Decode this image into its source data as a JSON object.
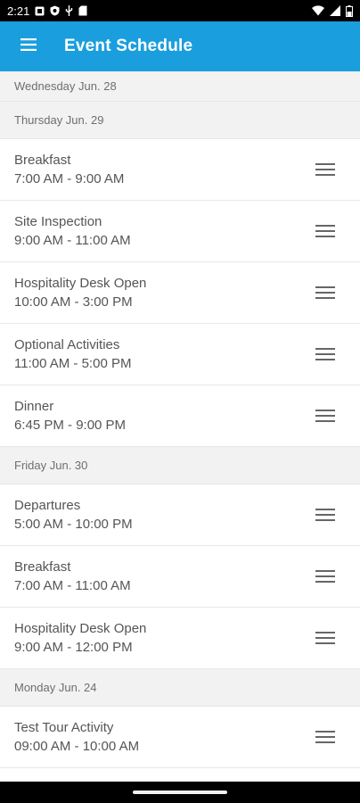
{
  "status_bar": {
    "time": "2:21",
    "icons_left": [
      "square-app-icon",
      "shield-icon",
      "usb-icon",
      "sd-card-icon"
    ],
    "icons_right": [
      "wifi-icon",
      "signal-icon",
      "battery-icon"
    ]
  },
  "app_bar": {
    "menu_icon": "hamburger-icon",
    "title": "Event Schedule",
    "color": "#1a9ede"
  },
  "sections": [
    {
      "date": "Wednesday Jun. 28",
      "events": []
    },
    {
      "date": "Thursday Jun. 29",
      "events": [
        {
          "name": "Breakfast",
          "time": "7:00 AM - 9:00 AM"
        },
        {
          "name": "Site Inspection",
          "time": "9:00 AM - 11:00 AM"
        },
        {
          "name": "Hospitality Desk Open",
          "time": "10:00 AM - 3:00 PM"
        },
        {
          "name": "Optional Activities",
          "time": "11:00 AM - 5:00 PM"
        },
        {
          "name": "Dinner",
          "time": "6:45 PM - 9:00 PM"
        }
      ]
    },
    {
      "date": "Friday Jun. 30",
      "events": [
        {
          "name": "Departures",
          "time": "5:00 AM - 10:00 PM"
        },
        {
          "name": "Breakfast",
          "time": "7:00 AM - 11:00 AM"
        },
        {
          "name": "Hospitality Desk Open",
          "time": "9:00 AM - 12:00 PM"
        }
      ]
    },
    {
      "date": "Monday Jun. 24",
      "events": [
        {
          "name": "Test Tour Activity",
          "time": "09:00 AM - 10:00 AM"
        }
      ]
    }
  ]
}
